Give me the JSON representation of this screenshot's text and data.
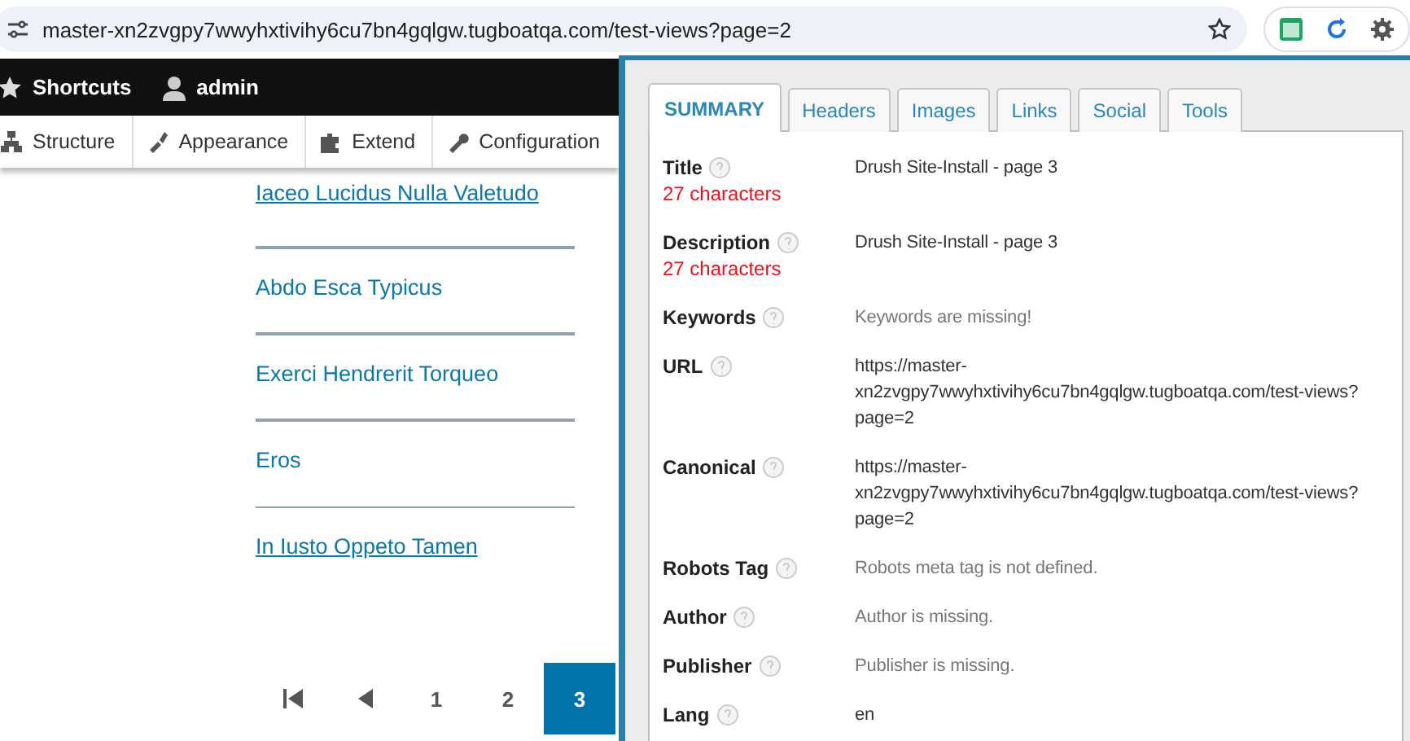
{
  "browser": {
    "url": "master-xn2zvgpy7wwyhxtivihy6cu7bn4gqlgw.tugboatqa.com/test-views?page=2"
  },
  "toolbar": {
    "items": [
      {
        "kind": "star",
        "label": "Shortcuts"
      },
      {
        "kind": "person",
        "label": "admin"
      }
    ]
  },
  "admin_menu": [
    {
      "kind": "structure",
      "label": "Structure"
    },
    {
      "kind": "appearance",
      "label": "Appearance"
    },
    {
      "kind": "extend",
      "label": "Extend"
    },
    {
      "kind": "configuration",
      "label": "Configuration"
    }
  ],
  "content_links": [
    {
      "label": "Iaceo Lucidus Nulla Valetudo",
      "underlined": true
    },
    {
      "label": "Abdo Esca Typicus",
      "underlined": false
    },
    {
      "label": "Exerci Hendrerit Torqueo",
      "underlined": false
    },
    {
      "label": "Eros",
      "underlined": false
    },
    {
      "label": "In Iusto Oppeto Tamen",
      "underlined": true
    }
  ],
  "pager": [
    {
      "kind": "first"
    },
    {
      "kind": "previous"
    },
    {
      "kind": "page",
      "label": "1",
      "selected": false
    },
    {
      "kind": "page",
      "label": "2",
      "selected": false
    },
    {
      "kind": "page",
      "label": "3",
      "selected": true
    }
  ],
  "seo_panel": {
    "tabs": [
      {
        "label": "SUMMARY",
        "selected": true
      },
      {
        "label": "Headers",
        "selected": false
      },
      {
        "label": "Images",
        "selected": false
      },
      {
        "label": "Links",
        "selected": false
      },
      {
        "label": "Social",
        "selected": false
      },
      {
        "label": "Tools",
        "selected": false
      }
    ],
    "rows": [
      {
        "label": "Title",
        "note": "27 characters",
        "kind": "value",
        "lines": [
          "Drush Site-Install - page 3"
        ]
      },
      {
        "label": "Description",
        "note": "27 characters",
        "kind": "value",
        "lines": [
          "Drush Site-Install - page 3"
        ]
      },
      {
        "label": "Keywords",
        "kind": "missing",
        "lines": [
          "Keywords are missing!"
        ]
      },
      {
        "label": "URL",
        "kind": "value",
        "lines": [
          "https://master-",
          "xn2zvgpy7wwyhxtivihy6cu7bn4gqlgw.tugboatqa.com/test-views?",
          "page=2"
        ]
      },
      {
        "label": "Canonical",
        "kind": "value",
        "lines": [
          "https://master-",
          "xn2zvgpy7wwyhxtivihy6cu7bn4gqlgw.tugboatqa.com/test-views?",
          "page=2"
        ]
      },
      {
        "label": "Robots Tag",
        "kind": "missing",
        "lines": [
          "Robots meta tag is not defined."
        ]
      },
      {
        "label": "Author",
        "kind": "missing",
        "lines": [
          "Author is missing."
        ]
      },
      {
        "label": "Publisher",
        "kind": "missing",
        "lines": [
          "Publisher is missing."
        ]
      },
      {
        "label": "Lang",
        "kind": "value",
        "lines": [
          "en"
        ]
      }
    ]
  }
}
